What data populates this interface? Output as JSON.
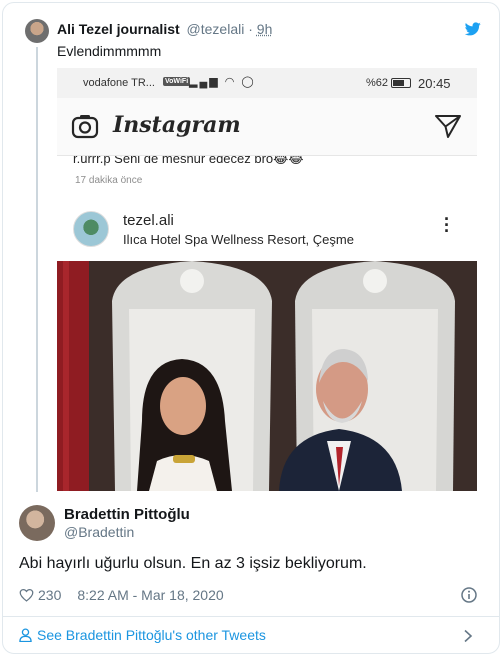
{
  "quoted_tweet": {
    "author_name": "Ali Tezel journalist",
    "handle": "@tezelali",
    "separator": " · ",
    "time": "9h",
    "text": "Evlendimmmmm"
  },
  "screenshot": {
    "status_bar": {
      "carrier": "vodafone TR...",
      "volte": "VoWiFi",
      "battery": "%62",
      "time": "20:45"
    },
    "app_logo": "Instagram",
    "comment_fragment": "r.urrr.p Seni de meshur edecez bro😂😂",
    "comment_age": "17 dakika önce",
    "post": {
      "username": "tezel.ali",
      "location": "Ilıca Hotel Spa Wellness Resort, Çeşme"
    }
  },
  "reply": {
    "author_name": "Bradettin Pittoğlu",
    "handle": "@Bradettin",
    "text": "Abi hayırlı uğurlu olsun. En az 3 işsiz bekliyorum.",
    "likes": "230",
    "timestamp": "8:22 AM - Mar 18, 2020"
  },
  "footer": {
    "link_text": "See Bradettin Pittoğlu's other Tweets"
  },
  "colors": {
    "link": "#1b95e0",
    "muted": "#657786",
    "border": "#e1e8ed"
  },
  "icons": [
    "twitter-bird-icon",
    "camera-icon",
    "direct-message-icon",
    "more-icon",
    "heart-icon",
    "info-icon",
    "person-icon",
    "chevron-right-icon"
  ]
}
